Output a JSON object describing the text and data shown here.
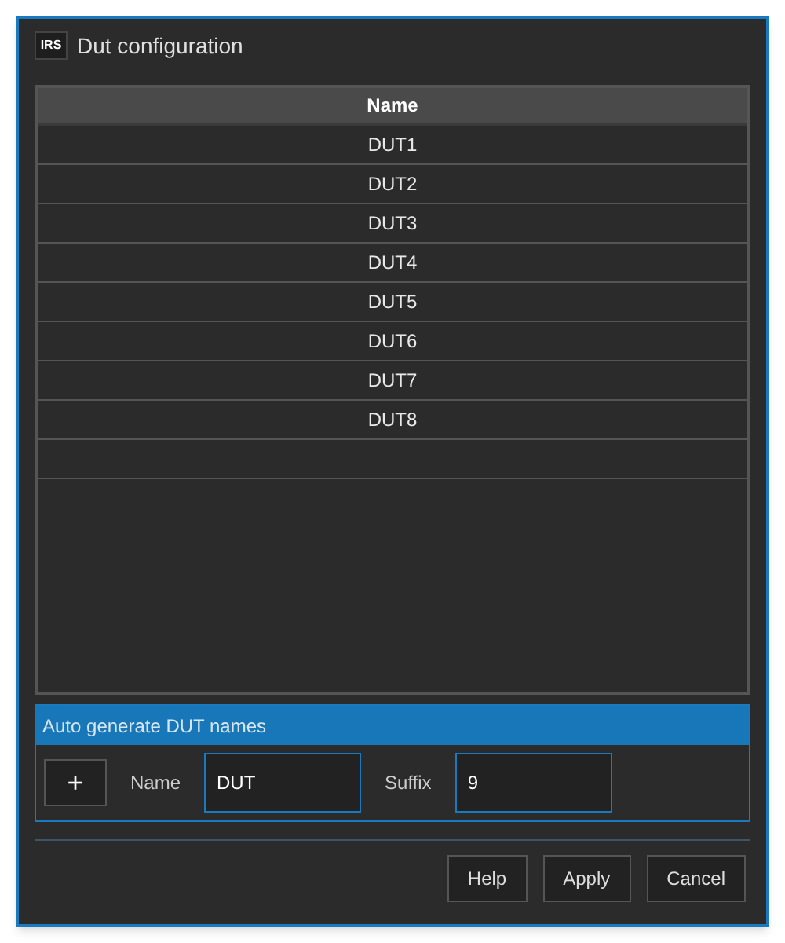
{
  "window": {
    "logo": "IRS",
    "title": "Dut configuration"
  },
  "table": {
    "columns": [
      "Name"
    ],
    "rows": [
      "DUT1",
      "DUT2",
      "DUT3",
      "DUT4",
      "DUT5",
      "DUT6",
      "DUT7",
      "DUT8"
    ]
  },
  "auto_generate": {
    "title": "Auto generate DUT names",
    "add_button": "+",
    "name_label": "Name",
    "name_value": "DUT",
    "suffix_label": "Suffix",
    "suffix_value": "9"
  },
  "buttons": [
    "Help",
    "Apply",
    "Cancel"
  ]
}
